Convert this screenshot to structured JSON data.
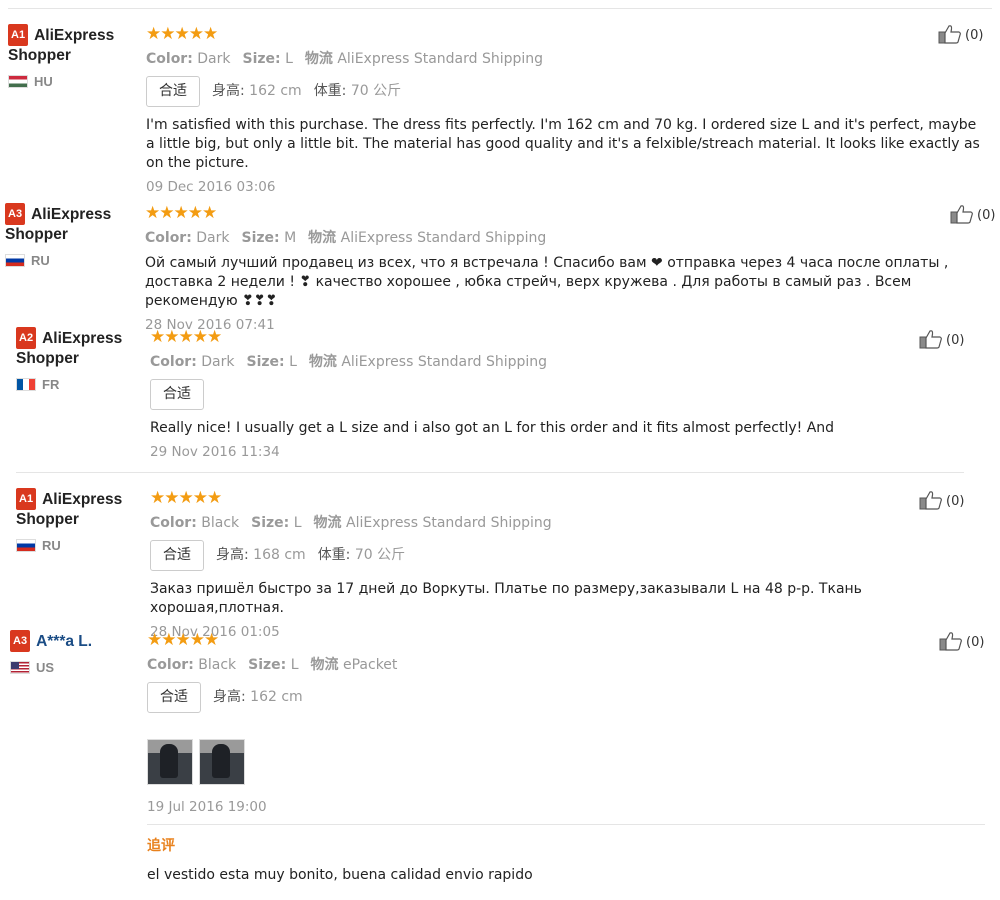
{
  "reviews": [
    {
      "level": "A1",
      "name": "AliExpress Shopper",
      "country": "HU",
      "stars": "★★★★★",
      "color_label": "Color:",
      "color": "Dark",
      "size_label": "Size:",
      "size": "L",
      "ship_label": "物流",
      "ship": "AliExpress Standard Shipping",
      "fit": "合适",
      "height_label": "身高:",
      "height": "162 cm",
      "weight_label": "体重:",
      "weight": "70 公斤",
      "text": "I'm satisfied with this purchase. The dress fits perfectly. I'm 162 cm and 70 kg. I ordered size L and it's perfect, maybe a little big, but only a little bit. The material has good quality and it's a felxible/streach material. It looks like exactly as on the picture.",
      "date": "09 Dec 2016 03:06",
      "likes": "(0)"
    },
    {
      "level": "A3",
      "name": "AliExpress Shopper",
      "country": "RU",
      "stars": "★★★★★",
      "color_label": "Color:",
      "color": "Dark",
      "size_label": "Size:",
      "size": "M",
      "ship_label": "物流",
      "ship": "AliExpress Standard Shipping",
      "text": "Ой самый лучший продавец из всех, что я встречала ! Спасибо вам ❤ отправка через 4 часа после оплаты , доставка 2 недели ! ❣ качество хорошее , юбка стрейч, верх кружева . Для работы в самый раз . Всем рекомендую ❣❣❣",
      "date": "28 Nov 2016 07:41",
      "likes": "(0)"
    },
    {
      "level": "A2",
      "name": "AliExpress Shopper",
      "country": "FR",
      "stars": "★★★★★",
      "color_label": "Color:",
      "color": "Dark",
      "size_label": "Size:",
      "size": "L",
      "ship_label": "物流",
      "ship": "AliExpress Standard Shipping",
      "fit": "合适",
      "text": "Really nice! I usually get a L size and i also got an L for this order and it fits almost perfectly! And",
      "date": "29 Nov 2016 11:34",
      "likes": "(0)"
    },
    {
      "level": "A1",
      "name": "AliExpress Shopper",
      "country": "RU",
      "stars": "★★★★★",
      "color_label": "Color:",
      "color": "Black",
      "size_label": "Size:",
      "size": "L",
      "ship_label": "物流",
      "ship": "AliExpress Standard Shipping",
      "fit": "合适",
      "height_label": "身高:",
      "height": "168 cm",
      "weight_label": "体重:",
      "weight": "70 公斤",
      "text": "Заказ пришёл быстро за 17 дней до Воркуты. Платье по размеру,заказывали L на 48 р-р. Ткань хорошая,плотная.",
      "date": "28 Nov 2016 01:05",
      "likes": "(0)"
    },
    {
      "level": "A3",
      "name": "A***a L.",
      "country": "US",
      "stars": "★★★★★",
      "color_label": "Color:",
      "color": "Black",
      "size_label": "Size:",
      "size": "L",
      "ship_label": "物流",
      "ship": "ePacket",
      "fit": "合适",
      "height_label": "身高:",
      "height": "162 cm",
      "date": "19 Jul 2016 19:00",
      "append_title": "追评",
      "append_text": "el vestido esta muy bonito, buena calidad envio rapido",
      "likes": "(0)"
    }
  ],
  "colors": {
    "badge": "#d9381e",
    "stars": "#f39c12",
    "append_title": "#e8811d",
    "name_blue": "#1a4c85"
  },
  "icons": {
    "like": "thumbs-up-icon"
  }
}
